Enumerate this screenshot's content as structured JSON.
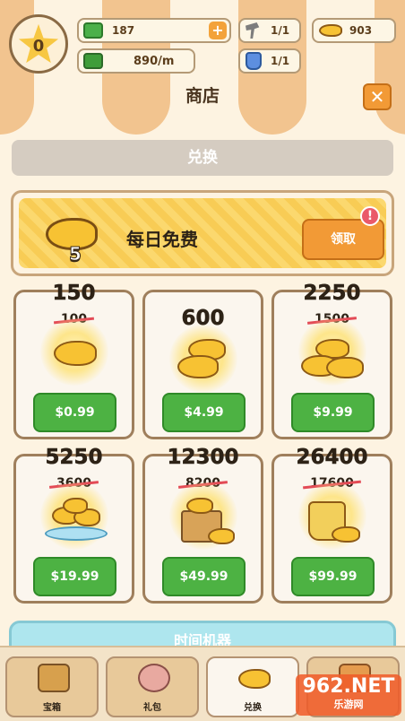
{
  "hud": {
    "level": "0",
    "cash": "187",
    "rate": "890/m",
    "hammers": "1/1",
    "jars": "1/1",
    "fish": "903"
  },
  "header": {
    "title": "商店",
    "close_icon": "close-x-icon"
  },
  "tab": {
    "label": "兑换"
  },
  "daily": {
    "count": "5",
    "label": "每日免费",
    "button": "领取",
    "badge": "!"
  },
  "offers": [
    {
      "amount": "150",
      "old": "100",
      "price": "$0.99"
    },
    {
      "amount": "600",
      "old": "",
      "price": "$4.99"
    },
    {
      "amount": "2250",
      "old": "1500",
      "price": "$9.99"
    },
    {
      "amount": "5250",
      "old": "3600",
      "price": "$19.99"
    },
    {
      "amount": "12300",
      "old": "8200",
      "price": "$49.99"
    },
    {
      "amount": "26400",
      "old": "17600",
      "price": "$99.99"
    }
  ],
  "time_machine": {
    "label": "时间机器"
  },
  "nav": [
    {
      "label": "宝箱",
      "icon": "chest-icon"
    },
    {
      "label": "礼包",
      "icon": "piggy-bank-icon"
    },
    {
      "label": "兑换",
      "icon": "fish-icon"
    },
    {
      "label": "",
      "icon": "box-icon"
    }
  ],
  "watermark": {
    "text": "962.NET",
    "sub": "乐游网"
  },
  "colors": {
    "accent_orange": "#f29a36",
    "price_green": "#4db243",
    "fish_yellow": "#f7c233",
    "strike_red": "#e34b56"
  }
}
